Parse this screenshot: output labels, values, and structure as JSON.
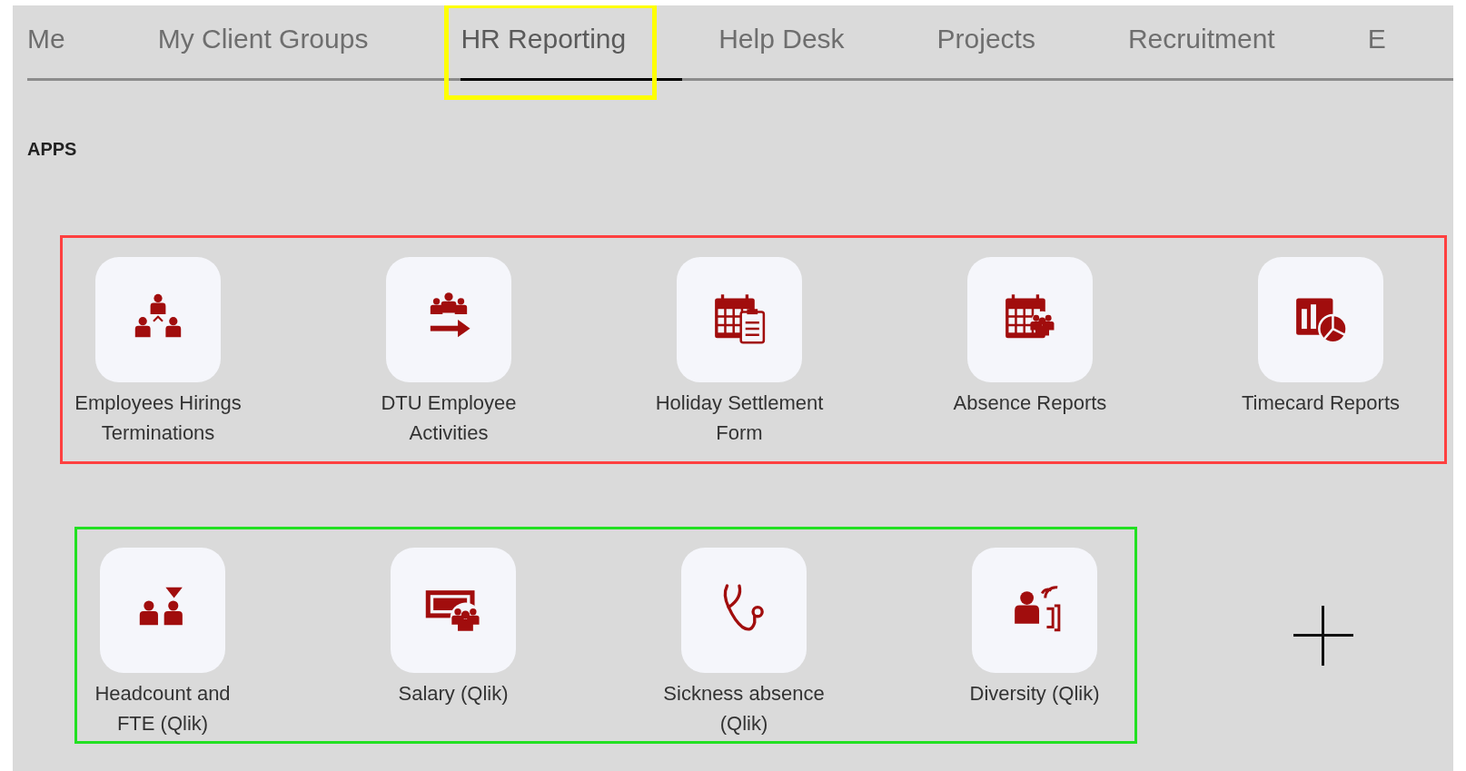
{
  "tabs": [
    {
      "label": "Me",
      "selected": false,
      "highlighted": false
    },
    {
      "label": "My Client Groups",
      "selected": false,
      "highlighted": false
    },
    {
      "label": "HR Reporting",
      "selected": true,
      "highlighted": true
    },
    {
      "label": "Help Desk",
      "selected": false,
      "highlighted": false
    },
    {
      "label": "Projects",
      "selected": false,
      "highlighted": false
    },
    {
      "label": "Recruitment",
      "selected": false,
      "highlighted": false
    },
    {
      "label": "E",
      "selected": false,
      "highlighted": false
    }
  ],
  "section_title": "APPS",
  "app_groups": [
    {
      "color": "#ff4040",
      "apps": [
        {
          "label": "Employees Hirings Terminations",
          "kind": "org"
        },
        {
          "label": "DTU Employee Activities",
          "kind": "group-arrow"
        },
        {
          "label": "Holiday Settlement Form",
          "kind": "calendar-clipboard"
        },
        {
          "label": "Absence Reports",
          "kind": "calendar-people"
        },
        {
          "label": "Timecard Reports",
          "kind": "chart"
        }
      ]
    },
    {
      "color": "#22e022",
      "apps": [
        {
          "label": "Headcount and FTE (Qlik)",
          "kind": "headcount"
        },
        {
          "label": "Salary (Qlik)",
          "kind": "money"
        },
        {
          "label": "Sickness absence (Qlik)",
          "kind": "stethoscope"
        },
        {
          "label": "Diversity (Qlik)",
          "kind": "speaking"
        }
      ]
    }
  ]
}
